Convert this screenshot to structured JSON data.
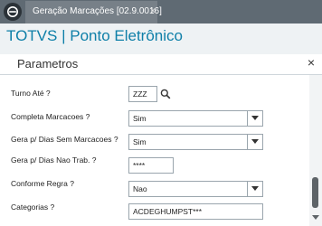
{
  "tab": {
    "title": "Geração Marcações [02.9.0016]",
    "close_glyph": "×"
  },
  "app": {
    "title": "TOTVS | Ponto Eletrônico",
    "logo_icon": "totvs-logo-icon"
  },
  "dialog": {
    "title": "Parametros",
    "close_glyph": "×",
    "fields": [
      {
        "label": "Turno Até ?",
        "value": "ZZZ",
        "type": "lookup"
      },
      {
        "label": "Completa Marcacoes ?",
        "value": "Sim",
        "type": "select"
      },
      {
        "label": "Gera p/ Dias Sem Marcacoes ?",
        "value": "Sim",
        "type": "select"
      },
      {
        "label": "Gera p/ Dias Nao Trab. ?",
        "value": "****",
        "type": "text"
      },
      {
        "label": "Conforme Regra ?",
        "value": "Nao",
        "type": "select"
      },
      {
        "label": "Categorias ?",
        "value": "ACDEGHUMPST***",
        "type": "text"
      }
    ]
  },
  "colors": {
    "accent": "#0e7fa8",
    "tabbar": "#5f6a73",
    "tab_active": "#778088"
  }
}
